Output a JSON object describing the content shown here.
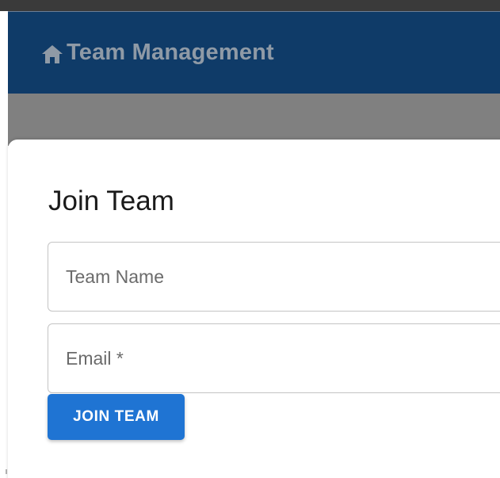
{
  "appbar": {
    "title": "Team Management",
    "icon": "home-icon"
  },
  "dialog": {
    "title": "Join Team",
    "team_name_field": {
      "placeholder": "Team Name",
      "value": ""
    },
    "email_field": {
      "placeholder": "Email *",
      "value": ""
    },
    "join_button_label": "JOIN TEAM"
  },
  "colors": {
    "appbar_bg": "#0f3b68",
    "appbar_text": "#8f9aa6",
    "backdrop": "#808080",
    "primary_button": "#1f74d3"
  }
}
